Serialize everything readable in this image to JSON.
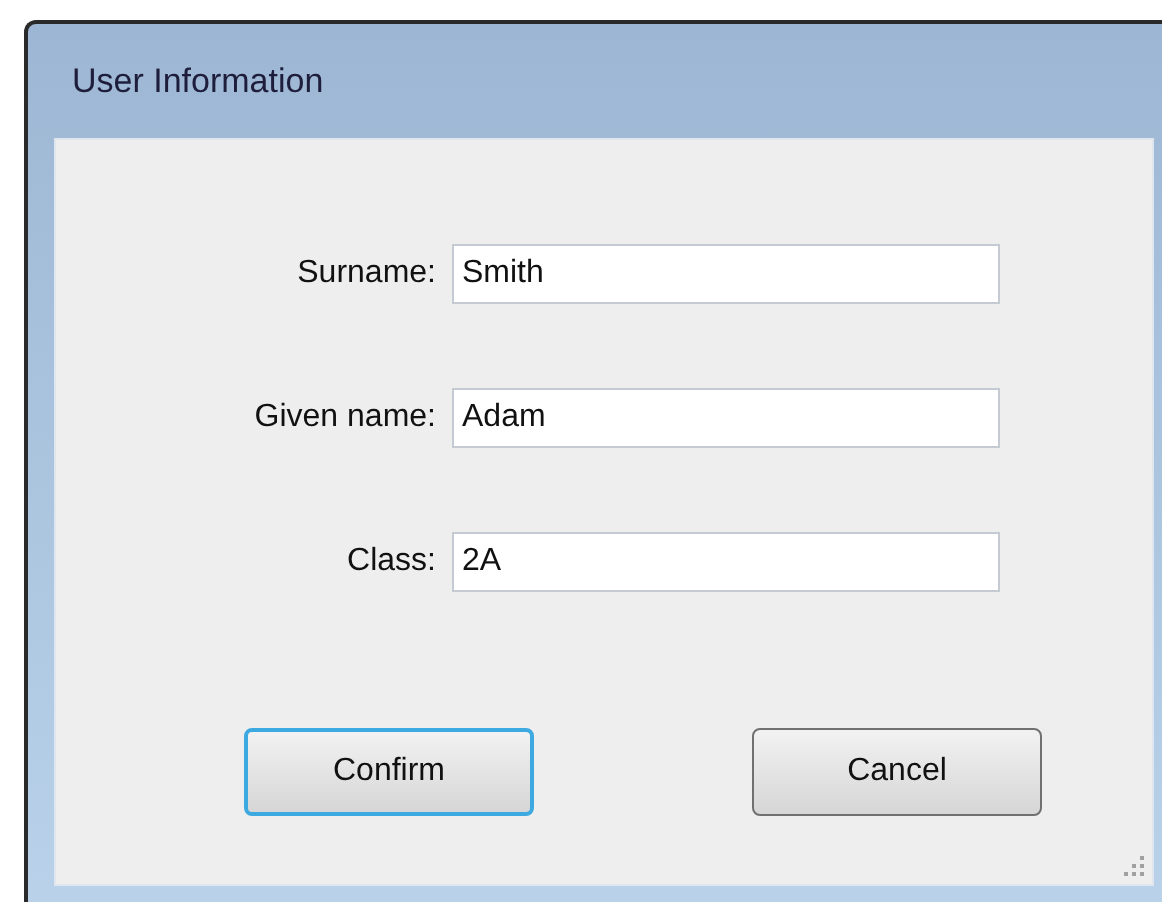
{
  "window": {
    "title": "User Information"
  },
  "fields": [
    {
      "label": "Surname:",
      "value": "Smith"
    },
    {
      "label": "Given name:",
      "value": "Adam"
    },
    {
      "label": "Class:",
      "value": "2A"
    }
  ],
  "buttons": [
    {
      "label": "Confirm",
      "default": true
    },
    {
      "label": "Cancel",
      "default": false
    }
  ]
}
